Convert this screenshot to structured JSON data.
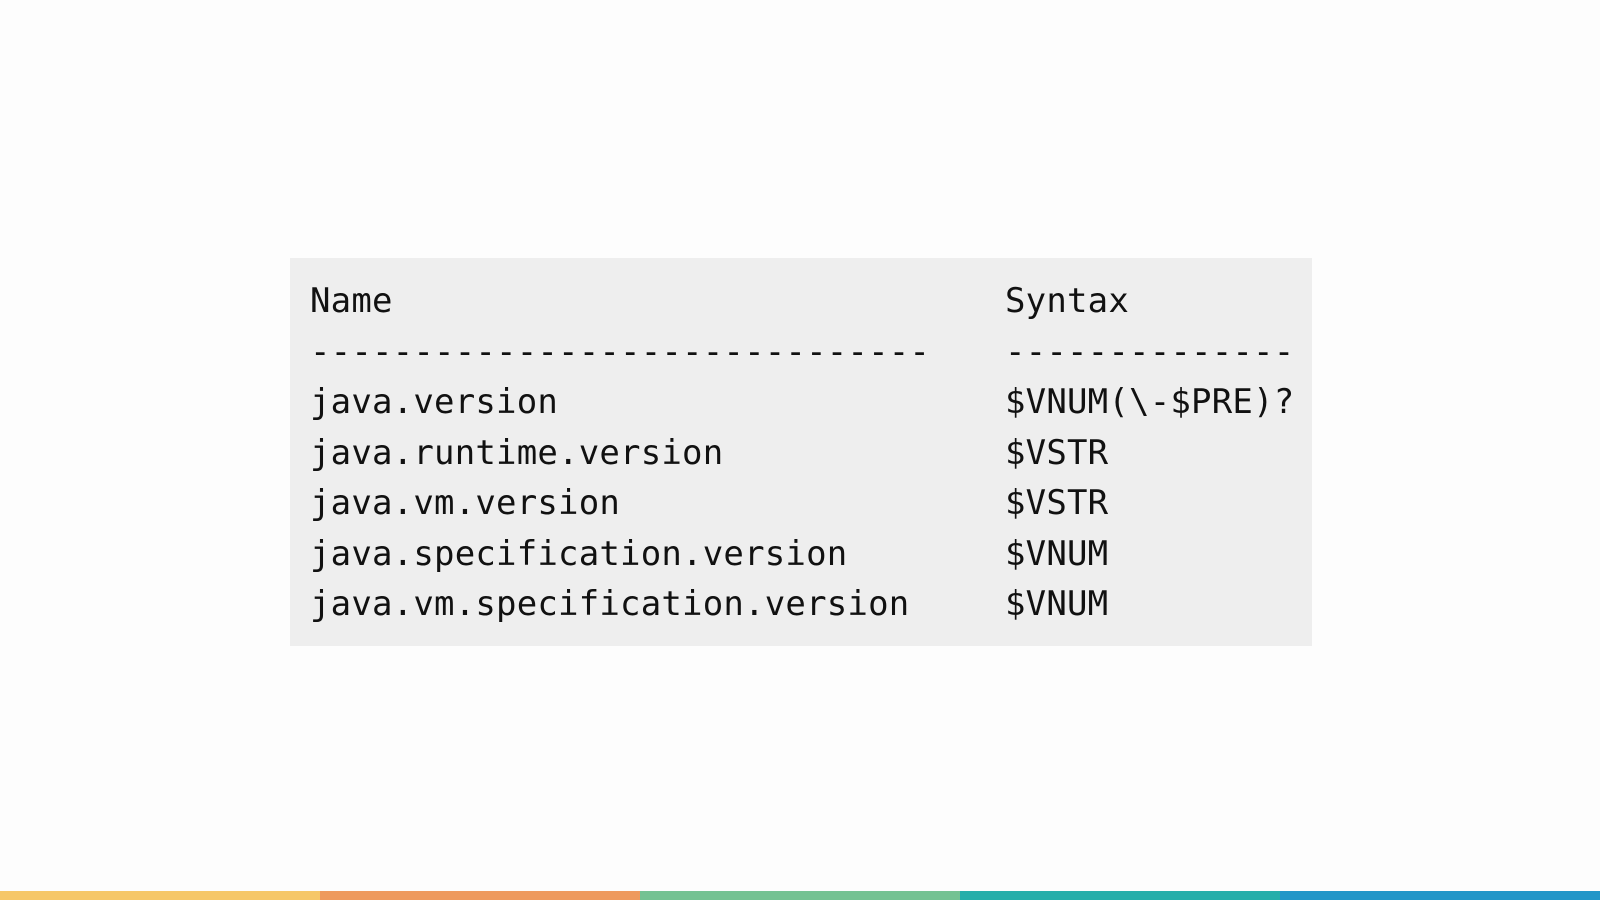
{
  "table": {
    "header": {
      "name": "Name",
      "syntax": "Syntax"
    },
    "separator": {
      "name": "------------------------------",
      "syntax": "--------------"
    },
    "rows": [
      {
        "name": "java.version",
        "syntax": "$VNUM(\\-$PRE)?"
      },
      {
        "name": "java.runtime.version",
        "syntax": "$VSTR"
      },
      {
        "name": "java.vm.version",
        "syntax": "$VSTR"
      },
      {
        "name": "java.specification.version",
        "syntax": "$VNUM"
      },
      {
        "name": "java.vm.specification.version",
        "syntax": "$VNUM"
      }
    ]
  },
  "colors": {
    "code_background": "#eeeeee",
    "text": "#111111",
    "accent_bar": [
      "#f6c768",
      "#ee9a5e",
      "#74c292",
      "#26aeaa",
      "#2296c8"
    ]
  }
}
